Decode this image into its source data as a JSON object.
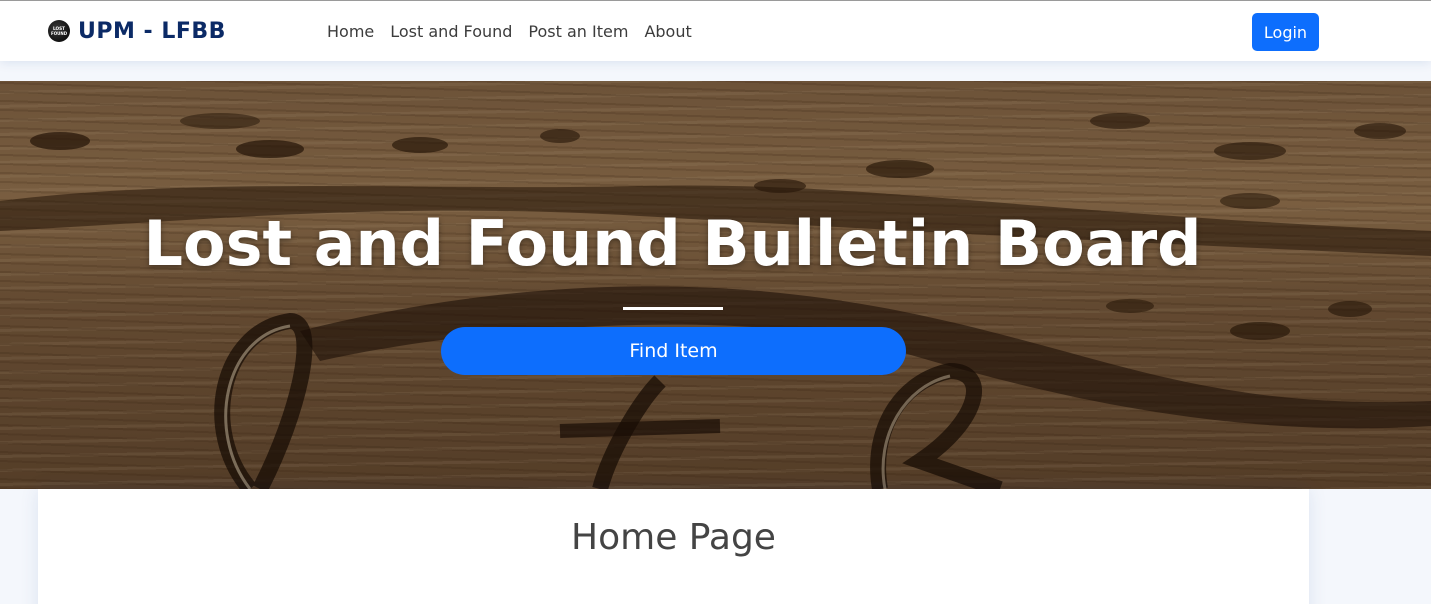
{
  "brand": {
    "name": "UPM - LFBB",
    "logo_text": "LOST FOUND",
    "logo_icon": "lost-found-logo-icon"
  },
  "nav": {
    "items": [
      {
        "label": "Home"
      },
      {
        "label": "Lost and Found"
      },
      {
        "label": "Post an Item"
      },
      {
        "label": "About"
      }
    ],
    "login_label": "Login"
  },
  "hero": {
    "title": "Lost and Found Bulletin Board",
    "button_label": "Find Item"
  },
  "main": {
    "page_title": "Home Page"
  },
  "colors": {
    "primary": "#0d6efd",
    "brand_text": "#0b2a66",
    "background": "#f4f7fc"
  }
}
